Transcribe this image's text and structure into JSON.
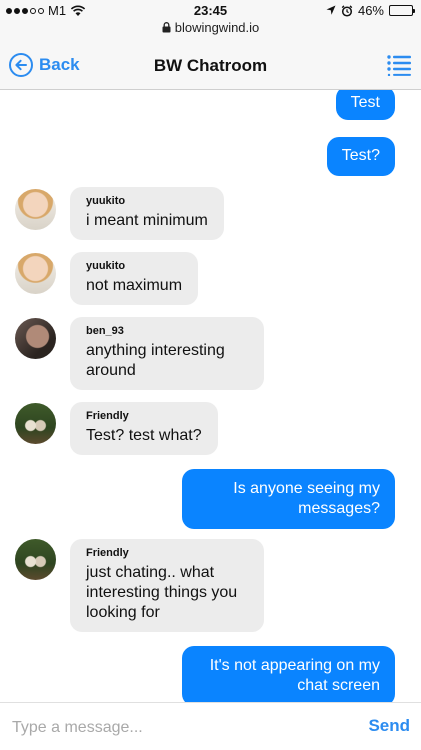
{
  "status_bar": {
    "carrier": "M1",
    "time": "23:45",
    "url": "blowingwind.io",
    "battery": "46%",
    "battery_level": 0.46
  },
  "nav": {
    "back_label": "Back",
    "title": "BW Chatroom",
    "accent_color": "#2c8cf0"
  },
  "messages": [
    {
      "direction": "out",
      "text": "Test"
    },
    {
      "direction": "out",
      "text": "Test?"
    },
    {
      "direction": "in",
      "sender": "yuukito",
      "text": "i meant minimum"
    },
    {
      "direction": "in",
      "sender": "yuukito",
      "text": "not maximum"
    },
    {
      "direction": "in",
      "sender": "ben_93",
      "text": "anything interesting around"
    },
    {
      "direction": "in",
      "sender": "Friendly",
      "text": "Test? test what?"
    },
    {
      "direction": "out",
      "text": "Is anyone seeing my messages?"
    },
    {
      "direction": "in",
      "sender": "Friendly",
      "text": "just chating.. what interesting things you looking for"
    },
    {
      "direction": "out",
      "text": "It's not appearing on my chat screen"
    }
  ],
  "composer": {
    "placeholder": "Type a message...",
    "value": "",
    "send_label": "Send"
  },
  "colors": {
    "outgoing_bubble": "#0a84ff",
    "incoming_bubble": "#ececec"
  }
}
